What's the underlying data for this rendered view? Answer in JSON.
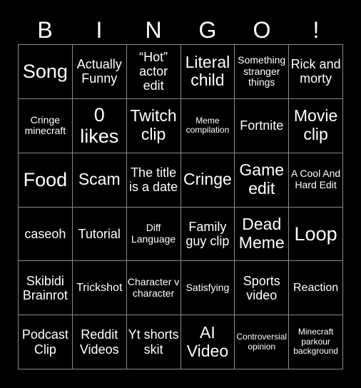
{
  "header": {
    "letters": [
      "B",
      "I",
      "N",
      "G",
      "O",
      "!"
    ]
  },
  "grid": {
    "rows": [
      [
        "Song",
        "Actually Funny",
        "“Hot” actor edit",
        "Literal child",
        "Something stranger things",
        "Rick and morty"
      ],
      [
        "Cringe minecraft",
        "0 likes",
        "Twitch clip",
        "Meme compilation",
        "Fortnite",
        "Movie clip"
      ],
      [
        "Food",
        "Scam",
        "The title is a date",
        "Cringe",
        "Game edit",
        "A Cool And Hard Edit"
      ],
      [
        "caseoh",
        "Tutorial",
        "Diff Language",
        "Family guy clip",
        "Dead Meme",
        "Loop"
      ],
      [
        "Skibidi Brainrot",
        "Trickshot",
        "Character v character",
        "Satisfying",
        "Sports video",
        "Reaction"
      ],
      [
        "Podcast Clip",
        "Reddit Videos",
        "Yt shorts skit",
        "AI Video",
        "Controversial opinion",
        "Minecraft parkour background"
      ]
    ]
  }
}
